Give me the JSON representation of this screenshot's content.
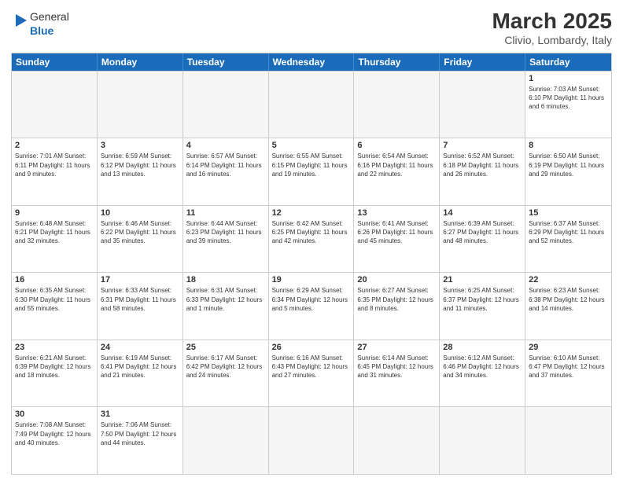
{
  "header": {
    "logo_general": "General",
    "logo_blue": "Blue",
    "month_year": "March 2025",
    "location": "Clivio, Lombardy, Italy"
  },
  "days_of_week": [
    "Sunday",
    "Monday",
    "Tuesday",
    "Wednesday",
    "Thursday",
    "Friday",
    "Saturday"
  ],
  "rows": [
    [
      {
        "day": "",
        "info": "",
        "empty": true
      },
      {
        "day": "",
        "info": "",
        "empty": true
      },
      {
        "day": "",
        "info": "",
        "empty": true
      },
      {
        "day": "",
        "info": "",
        "empty": true
      },
      {
        "day": "",
        "info": "",
        "empty": true
      },
      {
        "day": "",
        "info": "",
        "empty": true
      },
      {
        "day": "1",
        "info": "Sunrise: 7:03 AM\nSunset: 6:10 PM\nDaylight: 11 hours\nand 6 minutes.",
        "empty": false
      }
    ],
    [
      {
        "day": "2",
        "info": "Sunrise: 7:01 AM\nSunset: 6:11 PM\nDaylight: 11 hours\nand 9 minutes.",
        "empty": false
      },
      {
        "day": "3",
        "info": "Sunrise: 6:59 AM\nSunset: 6:12 PM\nDaylight: 11 hours\nand 13 minutes.",
        "empty": false
      },
      {
        "day": "4",
        "info": "Sunrise: 6:57 AM\nSunset: 6:14 PM\nDaylight: 11 hours\nand 16 minutes.",
        "empty": false
      },
      {
        "day": "5",
        "info": "Sunrise: 6:55 AM\nSunset: 6:15 PM\nDaylight: 11 hours\nand 19 minutes.",
        "empty": false
      },
      {
        "day": "6",
        "info": "Sunrise: 6:54 AM\nSunset: 6:16 PM\nDaylight: 11 hours\nand 22 minutes.",
        "empty": false
      },
      {
        "day": "7",
        "info": "Sunrise: 6:52 AM\nSunset: 6:18 PM\nDaylight: 11 hours\nand 26 minutes.",
        "empty": false
      },
      {
        "day": "8",
        "info": "Sunrise: 6:50 AM\nSunset: 6:19 PM\nDaylight: 11 hours\nand 29 minutes.",
        "empty": false
      }
    ],
    [
      {
        "day": "9",
        "info": "Sunrise: 6:48 AM\nSunset: 6:21 PM\nDaylight: 11 hours\nand 32 minutes.",
        "empty": false
      },
      {
        "day": "10",
        "info": "Sunrise: 6:46 AM\nSunset: 6:22 PM\nDaylight: 11 hours\nand 35 minutes.",
        "empty": false
      },
      {
        "day": "11",
        "info": "Sunrise: 6:44 AM\nSunset: 6:23 PM\nDaylight: 11 hours\nand 39 minutes.",
        "empty": false
      },
      {
        "day": "12",
        "info": "Sunrise: 6:42 AM\nSunset: 6:25 PM\nDaylight: 11 hours\nand 42 minutes.",
        "empty": false
      },
      {
        "day": "13",
        "info": "Sunrise: 6:41 AM\nSunset: 6:26 PM\nDaylight: 11 hours\nand 45 minutes.",
        "empty": false
      },
      {
        "day": "14",
        "info": "Sunrise: 6:39 AM\nSunset: 6:27 PM\nDaylight: 11 hours\nand 48 minutes.",
        "empty": false
      },
      {
        "day": "15",
        "info": "Sunrise: 6:37 AM\nSunset: 6:29 PM\nDaylight: 11 hours\nand 52 minutes.",
        "empty": false
      }
    ],
    [
      {
        "day": "16",
        "info": "Sunrise: 6:35 AM\nSunset: 6:30 PM\nDaylight: 11 hours\nand 55 minutes.",
        "empty": false
      },
      {
        "day": "17",
        "info": "Sunrise: 6:33 AM\nSunset: 6:31 PM\nDaylight: 11 hours\nand 58 minutes.",
        "empty": false
      },
      {
        "day": "18",
        "info": "Sunrise: 6:31 AM\nSunset: 6:33 PM\nDaylight: 12 hours\nand 1 minute.",
        "empty": false
      },
      {
        "day": "19",
        "info": "Sunrise: 6:29 AM\nSunset: 6:34 PM\nDaylight: 12 hours\nand 5 minutes.",
        "empty": false
      },
      {
        "day": "20",
        "info": "Sunrise: 6:27 AM\nSunset: 6:35 PM\nDaylight: 12 hours\nand 8 minutes.",
        "empty": false
      },
      {
        "day": "21",
        "info": "Sunrise: 6:25 AM\nSunset: 6:37 PM\nDaylight: 12 hours\nand 11 minutes.",
        "empty": false
      },
      {
        "day": "22",
        "info": "Sunrise: 6:23 AM\nSunset: 6:38 PM\nDaylight: 12 hours\nand 14 minutes.",
        "empty": false
      }
    ],
    [
      {
        "day": "23",
        "info": "Sunrise: 6:21 AM\nSunset: 6:39 PM\nDaylight: 12 hours\nand 18 minutes.",
        "empty": false
      },
      {
        "day": "24",
        "info": "Sunrise: 6:19 AM\nSunset: 6:41 PM\nDaylight: 12 hours\nand 21 minutes.",
        "empty": false
      },
      {
        "day": "25",
        "info": "Sunrise: 6:17 AM\nSunset: 6:42 PM\nDaylight: 12 hours\nand 24 minutes.",
        "empty": false
      },
      {
        "day": "26",
        "info": "Sunrise: 6:16 AM\nSunset: 6:43 PM\nDaylight: 12 hours\nand 27 minutes.",
        "empty": false
      },
      {
        "day": "27",
        "info": "Sunrise: 6:14 AM\nSunset: 6:45 PM\nDaylight: 12 hours\nand 31 minutes.",
        "empty": false
      },
      {
        "day": "28",
        "info": "Sunrise: 6:12 AM\nSunset: 6:46 PM\nDaylight: 12 hours\nand 34 minutes.",
        "empty": false
      },
      {
        "day": "29",
        "info": "Sunrise: 6:10 AM\nSunset: 6:47 PM\nDaylight: 12 hours\nand 37 minutes.",
        "empty": false
      }
    ],
    [
      {
        "day": "30",
        "info": "Sunrise: 7:08 AM\nSunset: 7:49 PM\nDaylight: 12 hours\nand 40 minutes.",
        "empty": false
      },
      {
        "day": "31",
        "info": "Sunrise: 7:06 AM\nSunset: 7:50 PM\nDaylight: 12 hours\nand 44 minutes.",
        "empty": false
      },
      {
        "day": "",
        "info": "",
        "empty": true
      },
      {
        "day": "",
        "info": "",
        "empty": true
      },
      {
        "day": "",
        "info": "",
        "empty": true
      },
      {
        "day": "",
        "info": "",
        "empty": true
      },
      {
        "day": "",
        "info": "",
        "empty": true
      }
    ]
  ]
}
